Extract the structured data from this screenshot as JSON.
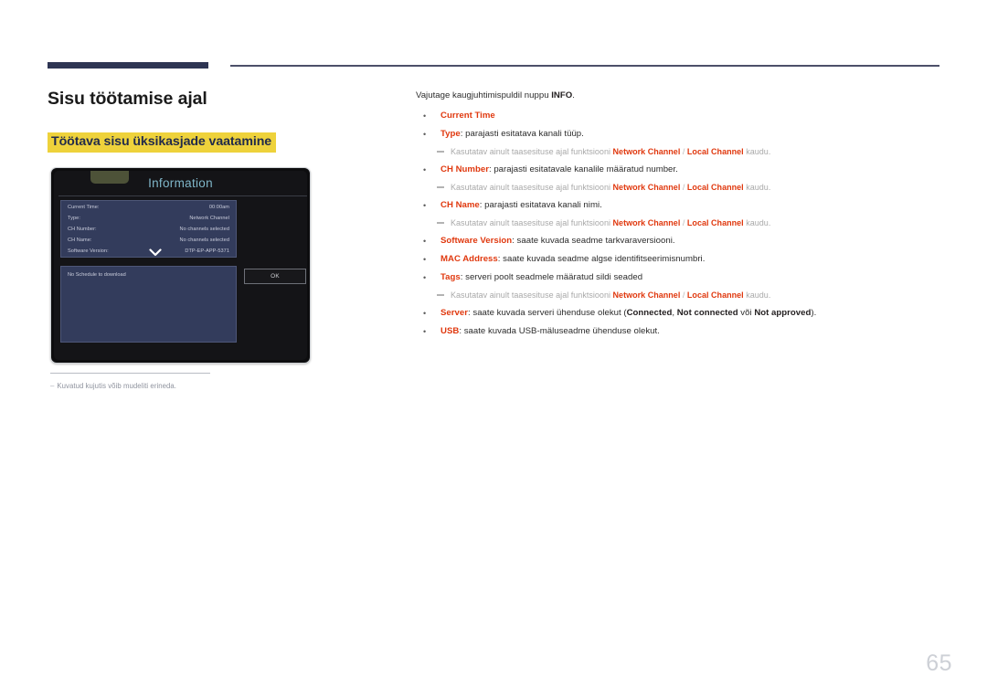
{
  "page": {
    "title": "Sisu töötamise ajal",
    "subtitle": "Töötava sisu üksikasjade vaatamine",
    "number": "65"
  },
  "colors": {
    "accent_red": "#e0380e",
    "highlight_yellow": "#eed23b",
    "navy_bar": "#2e3553",
    "panel_blue": "#333c5c",
    "muted_grey": "#a9a9a9"
  },
  "tv_screen": {
    "dialog_title": "Information",
    "rows": [
      {
        "key": "Current Time:",
        "value": "00:00am"
      },
      {
        "key": "Type:",
        "value": "Network Channel"
      },
      {
        "key": "CH Number:",
        "value": "No channels selected"
      },
      {
        "key": "CH Name:",
        "value": "No channels selected"
      },
      {
        "key": "Software Version:",
        "value": "DTP-EP-APP-5371"
      }
    ],
    "schedule_text": "No Schedule to download",
    "ok_label": "OK",
    "scroll_icon": "chevron-down-icon"
  },
  "footnote": {
    "dash": "–",
    "text": "Kuvatud kujutis võib mudeliti erineda."
  },
  "content": {
    "intro_before": "Vajutage kaugjuhtimispuldil nuppu ",
    "intro_bold": "INFO",
    "intro_after": ".",
    "subnote_common": {
      "pre": "Kasutatav ainult taasesituse ajal funktsiooni ",
      "hl1": "Network Channel",
      "sep": " / ",
      "hl2": "Local Channel",
      "post": " kaudu."
    },
    "items": [
      {
        "term": "Current Time",
        "desc": ""
      },
      {
        "term": "Type",
        "desc": ": parajasti esitatava kanali tüüp."
      },
      {
        "term": "CH Number",
        "desc": ": parajasti esitatavale kanalile määratud number."
      },
      {
        "term": "CH Name",
        "desc": ": parajasti esitatava kanali nimi."
      },
      {
        "term": "Software Version",
        "desc": ": saate kuvada seadme tarkvaraversiooni."
      },
      {
        "term": "MAC Address",
        "desc": ": saate kuvada seadme algse identifitseerimisnumbri."
      },
      {
        "term": "Tags",
        "desc": ": serveri poolt seadmele määratud sildi seaded"
      },
      {
        "term": "Server",
        "desc": ": saate kuvada serveri ühenduse olekut ("
      },
      {
        "term": "USB",
        "desc": ": saate kuvada USB-mäluseadme ühenduse olekut."
      }
    ],
    "server_statuses": {
      "s1": "Connected",
      "comma": ", ",
      "s2": "Not connected",
      "voi": " või ",
      "s3": "Not approved",
      "tail": ")."
    }
  }
}
